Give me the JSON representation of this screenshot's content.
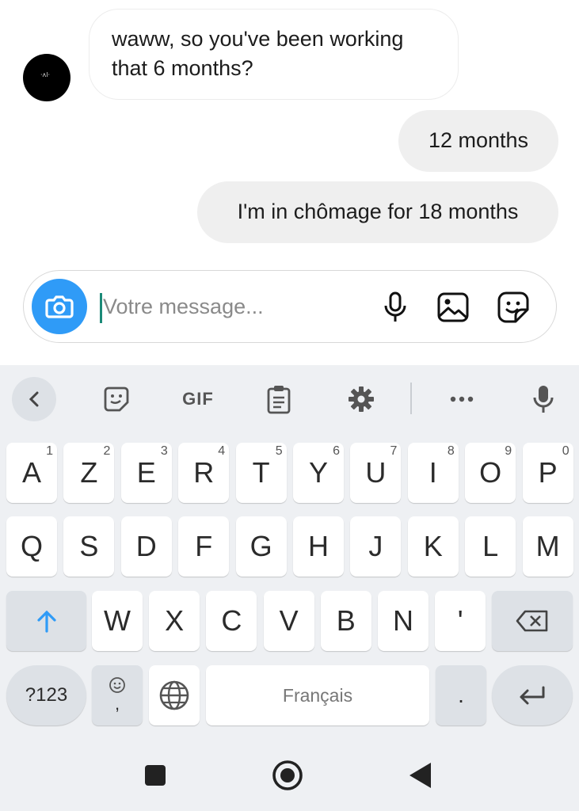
{
  "chat": {
    "avatar_text": "·ʌl·",
    "incoming": {
      "line1": "waww, so you've been working",
      "line2": "that 6 months?"
    },
    "outgoing": [
      "12 months",
      "I'm in chômage for 18 months"
    ]
  },
  "composer": {
    "placeholder": "Votre message...",
    "icons": [
      "camera-icon",
      "microphone-icon",
      "gallery-icon",
      "sticker-icon"
    ],
    "accent": "#2f9bf7"
  },
  "keyboard": {
    "toolbar": {
      "gif_label": "GIF",
      "icons": [
        "back-icon",
        "sticker-icon",
        "gif-icon",
        "clipboard-icon",
        "settings-icon",
        "more-icon",
        "voice-icon"
      ]
    },
    "row1": [
      {
        "k": "A",
        "h": "1"
      },
      {
        "k": "Z",
        "h": "2"
      },
      {
        "k": "E",
        "h": "3"
      },
      {
        "k": "R",
        "h": "4"
      },
      {
        "k": "T",
        "h": "5"
      },
      {
        "k": "Y",
        "h": "6"
      },
      {
        "k": "U",
        "h": "7"
      },
      {
        "k": "I",
        "h": "8"
      },
      {
        "k": "O",
        "h": "9"
      },
      {
        "k": "P",
        "h": "0"
      }
    ],
    "row2": [
      "Q",
      "S",
      "D",
      "F",
      "G",
      "H",
      "J",
      "K",
      "L",
      "M"
    ],
    "row3": [
      "W",
      "X",
      "C",
      "V",
      "B",
      "N",
      "'"
    ],
    "symbols_label": "?123",
    "comma_label": ",",
    "space_label": "Français",
    "period_label": ".",
    "shift_color": "#2f9bf7"
  }
}
